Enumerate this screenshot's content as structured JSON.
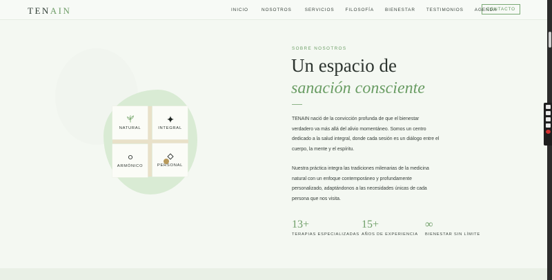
{
  "brand": {
    "logo_main": "TEN",
    "logo_accent": "AIN"
  },
  "nav": {
    "links": [
      "INICIO",
      "NOSOTROS",
      "SERVICIOS",
      "FILOSOFÍA",
      "BIENESTAR",
      "TESTIMONIOS",
      "AGENDA"
    ],
    "cta_label": "CONTACTO"
  },
  "pillars": [
    {
      "label": "NATURAL",
      "icon": "leaf-icon"
    },
    {
      "label": "INTEGRAL",
      "icon": "sparkle-icon"
    },
    {
      "label": "ARMÓNICO",
      "icon": "circle-icon"
    },
    {
      "label": "PERSONAL",
      "icon": "diamond-icon"
    }
  ],
  "about": {
    "eyebrow": "SOBRE NOSOTROS",
    "title_line1": "Un espacio de",
    "title_line2": "sanación consciente",
    "paragraph1": "TENAIN nació de la convicción profunda de que el bienestar verdadero va más allá del alivio momentáneo. Somos un centro dedicado a la salud integral, donde cada sesión es un diálogo entre el cuerpo, la mente y el espíritu.",
    "paragraph2": "Nuestra práctica integra las tradiciones milenarias de la medicina natural con un enfoque contemporáneo y profundamente personalizado, adaptándonos a las necesidades únicas de cada persona que nos visita."
  },
  "stats": [
    {
      "value": "13+",
      "caption": "TERAPIAS ESPECIALIZADAS"
    },
    {
      "value": "15+",
      "caption": "AÑOS DE EXPERIENCIA"
    },
    {
      "value": "∞",
      "caption": "BIENESTAR SIN LÍMITE"
    }
  ],
  "colors": {
    "accent_green": "#6a9d64",
    "background": "#f4f8f2",
    "blob": "#d9ebd4",
    "gold": "#b8995a"
  }
}
